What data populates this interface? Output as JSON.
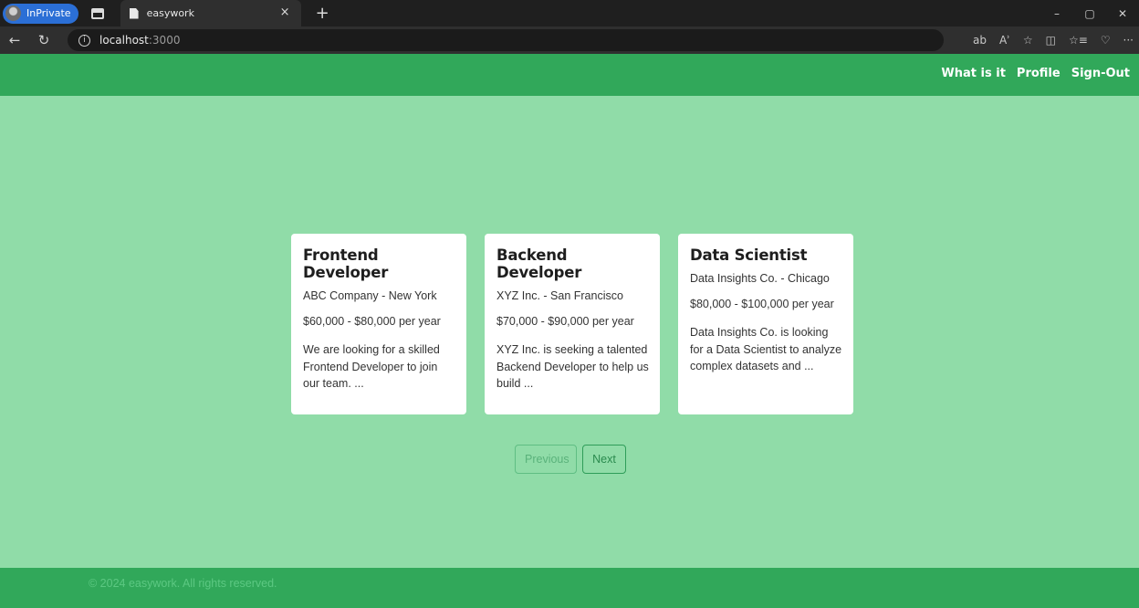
{
  "browser": {
    "inprivate_label": "InPrivate",
    "tab_title": "easywork",
    "tab_close": "×",
    "new_tab": "+",
    "url_host": "localhost",
    "url_port": ":3000",
    "window_controls": [
      "–",
      "▢",
      "✕"
    ],
    "tools": [
      "ab",
      "Aʾ",
      "☆",
      "◫",
      "☆≡",
      "♡",
      "···"
    ]
  },
  "navbar": {
    "links": [
      "What is it",
      "Profile",
      "Sign-Out"
    ]
  },
  "jobs": [
    {
      "title": "Frontend Developer",
      "company": "ABC Company - New York",
      "salary": "$60,000 - $80,000 per year",
      "description": "We are looking for a skilled Frontend Developer to join our team. ..."
    },
    {
      "title": "Backend Developer",
      "company": "XYZ Inc. - San Francisco",
      "salary": "$70,000 - $90,000 per year",
      "description": "XYZ Inc. is seeking a talented Backend Developer to help us build ..."
    },
    {
      "title": "Data Scientist",
      "company": "Data Insights Co. - Chicago",
      "salary": "$80,000 - $100,000 per year",
      "description": "Data Insights Co. is looking for a Data Scientist to analyze complex datasets and ..."
    }
  ],
  "pagination": {
    "previous_label": "Previous",
    "next_label": "Next"
  },
  "footer": {
    "text": "© 2024 easywork. All rights reserved."
  },
  "colors": {
    "navbar": "#31a85a",
    "page_background": "#90dca8",
    "card_background": "#ffffff"
  }
}
